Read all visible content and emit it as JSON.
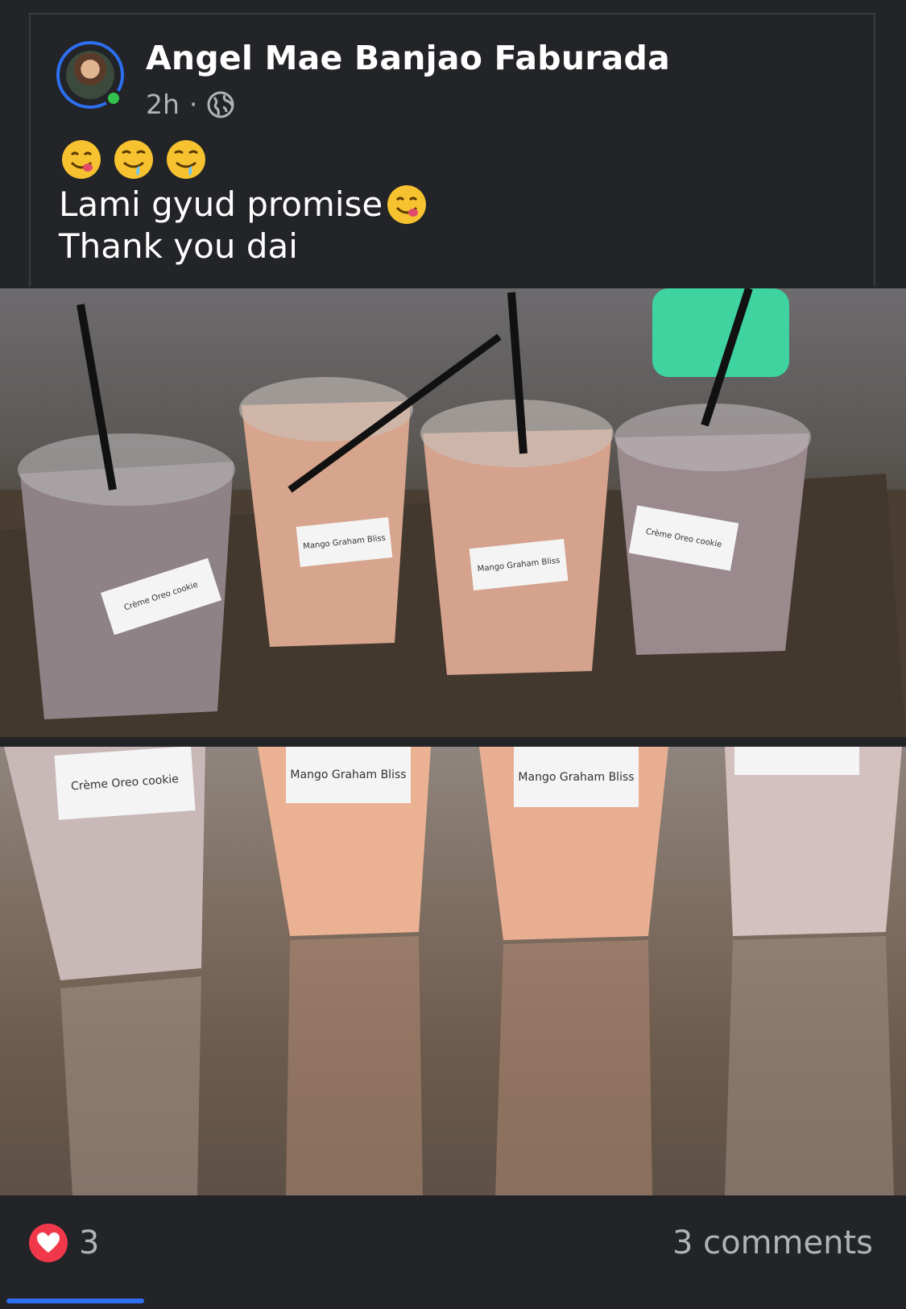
{
  "post": {
    "author": "Angel Mae Banjao Faburada",
    "time": "2h",
    "separator": "·",
    "privacy_icon": "globe-icon",
    "emoji_row": [
      "yum-emoji",
      "drooling-emoji",
      "drooling-emoji"
    ],
    "text_line1": "Lami gyud promise",
    "text_line1_emoji": "yum-emoji",
    "text_line2": "Thank you dai"
  },
  "photos": {
    "top_labels": [
      "Crème Oreo cookie",
      "Mango Graham Bliss",
      "Mango Graham Bliss",
      "Crème Oreo cookie"
    ],
    "bottom_labels": [
      "Crème Oreo cookie",
      "Mango Graham Bliss",
      "Mango Graham Bliss",
      ""
    ]
  },
  "footer": {
    "reaction_icon": "heart-icon",
    "reaction_count": "3",
    "comments": "3 comments"
  },
  "colors": {
    "background": "#222427",
    "accent": "#2d6ff0",
    "online": "#31c24d",
    "heart": "#f0384a"
  }
}
